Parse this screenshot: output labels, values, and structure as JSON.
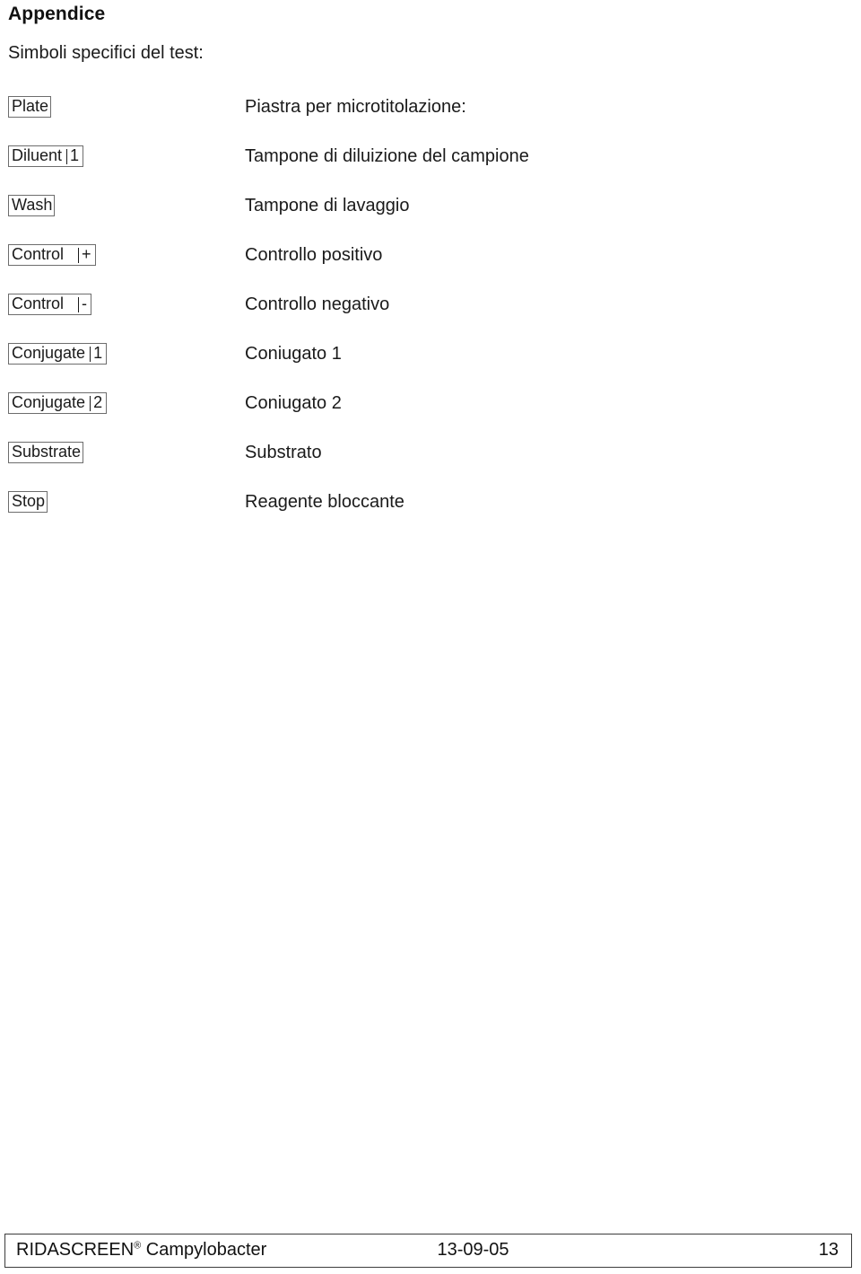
{
  "page": {
    "title": "Appendice",
    "subtitle": "Simboli specifici del test:"
  },
  "symbols": [
    {
      "symbol_word": "Plate",
      "symbol_separator": "",
      "symbol_suffix": "",
      "description": "Piastra per microtitolazione:"
    },
    {
      "symbol_word": "Diluent",
      "symbol_separator": "|",
      "symbol_suffix": "1",
      "description": "Tampone di diluizione del campione"
    },
    {
      "symbol_word": "Wash",
      "symbol_separator": "",
      "symbol_suffix": "",
      "description": "Tampone di lavaggio"
    },
    {
      "symbol_word": "Control",
      "symbol_separator": "|",
      "symbol_suffix": "+",
      "description": "Controllo positivo"
    },
    {
      "symbol_word": "Control",
      "symbol_separator": "|",
      "symbol_suffix": "-",
      "description": "Controllo negativo"
    },
    {
      "symbol_word": "Conjugate",
      "symbol_separator": "|",
      "symbol_suffix": "1",
      "description": "Coniugato 1"
    },
    {
      "symbol_word": "Conjugate",
      "symbol_separator": "|",
      "symbol_suffix": "2",
      "description": "Coniugato 2"
    },
    {
      "symbol_word": "Substrate",
      "symbol_separator": "",
      "symbol_suffix": "",
      "description": "Substrato"
    },
    {
      "symbol_word": "Stop",
      "symbol_separator": "",
      "symbol_suffix": "",
      "description": "Reagente bloccante"
    }
  ],
  "footer": {
    "product_name": "RIDASCREEN",
    "registered_mark": "®",
    "product_suffix": " Campylobacter",
    "date": "13-09-05",
    "page_number": "13"
  },
  "colors": {
    "text": "#1a1a1a",
    "box_border": "#6d6d6d",
    "footer_border": "#3c3c3c",
    "background": "#ffffff"
  }
}
